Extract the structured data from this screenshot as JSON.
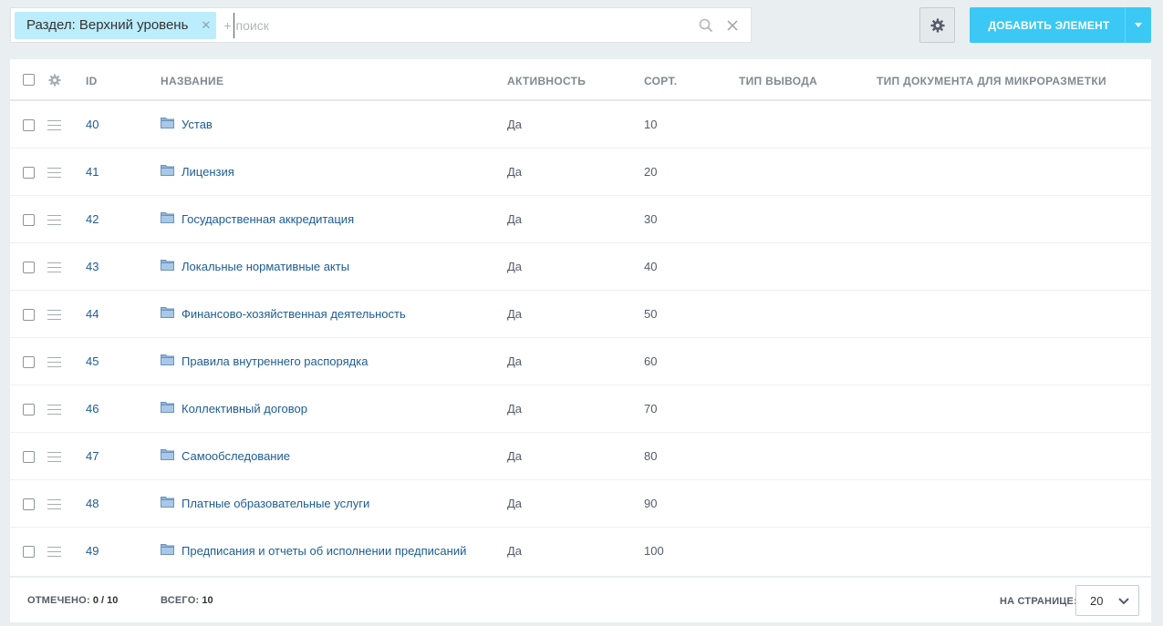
{
  "filter": {
    "tag_label": "Раздел: Верхний уровень",
    "plus": "+",
    "search_placeholder": "поиск"
  },
  "toolbar": {
    "add_label": "ДОБАВИТЬ ЭЛЕМЕНТ"
  },
  "grid": {
    "columns": {
      "id": "ID",
      "name": "НАЗВАНИЕ",
      "active": "АКТИВНОСТЬ",
      "sort": "СОРТ.",
      "output_type": "ТИП ВЫВОДА",
      "doc_type": "ТИП ДОКУМЕНТА ДЛЯ МИКРОРАЗМЕТКИ"
    },
    "rows": [
      {
        "id": "40",
        "name": "Устав",
        "active": "Да",
        "sort": "10"
      },
      {
        "id": "41",
        "name": "Лицензия",
        "active": "Да",
        "sort": "20"
      },
      {
        "id": "42",
        "name": "Государственная аккредитация",
        "active": "Да",
        "sort": "30"
      },
      {
        "id": "43",
        "name": "Локальные нормативные акты",
        "active": "Да",
        "sort": "40"
      },
      {
        "id": "44",
        "name": "Финансово-хозяйственная деятельность",
        "active": "Да",
        "sort": "50"
      },
      {
        "id": "45",
        "name": "Правила внутреннего распорядка",
        "active": "Да",
        "sort": "60"
      },
      {
        "id": "46",
        "name": "Коллективный договор",
        "active": "Да",
        "sort": "70"
      },
      {
        "id": "47",
        "name": "Самообследование",
        "active": "Да",
        "sort": "80"
      },
      {
        "id": "48",
        "name": "Платные образовательные услуги",
        "active": "Да",
        "sort": "90"
      },
      {
        "id": "49",
        "name": "Предписания и отчеты об исполнении предписаний",
        "active": "Да",
        "sort": "100"
      }
    ]
  },
  "footer": {
    "selected_label": "ОТМЕЧЕНО:",
    "selected_value": "0 / 10",
    "total_label": "ВСЕГО:",
    "total_value": "10",
    "per_page_label": "НА СТРАНИЦЕ:",
    "per_page_value": "20"
  },
  "colors": {
    "accent": "#3bc8f5",
    "filter_tag": "#bcedfc",
    "link": "#1c5c94",
    "background": "#e9eef0"
  }
}
